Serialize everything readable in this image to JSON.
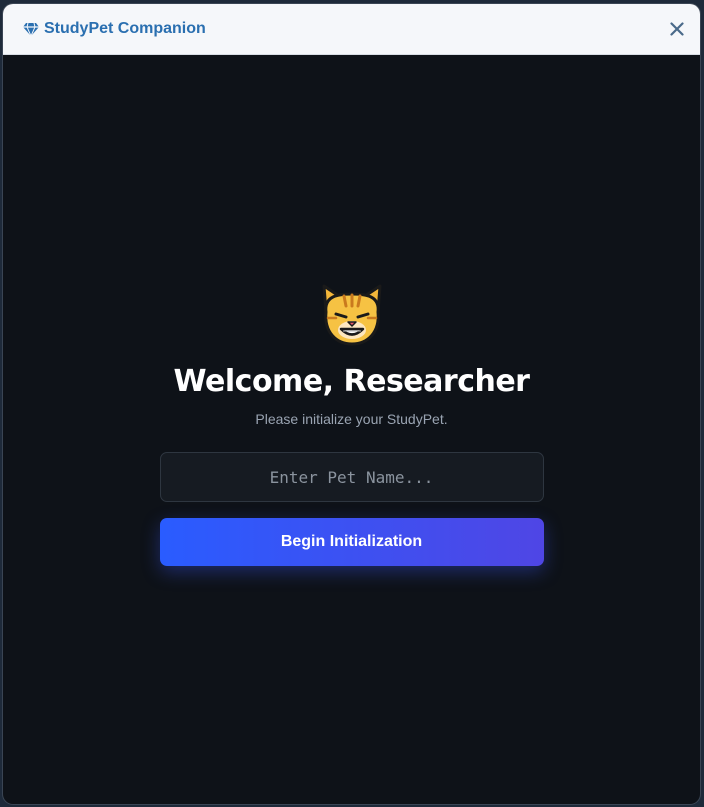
{
  "window": {
    "title": "StudyPet Companion",
    "title_icon": "diamond-icon",
    "close_icon": "close-icon"
  },
  "main": {
    "avatar_icon": "cat-face-icon",
    "heading": "Welcome, Researcher",
    "subtitle": "Please initialize your StudyPet.",
    "pet_name_placeholder": "Enter Pet Name...",
    "pet_name_value": "",
    "begin_label": "Begin Initialization"
  },
  "colors": {
    "titlebar_bg": "#f5f7fa",
    "title_text": "#2a6fb0",
    "content_bg": "#0e1218",
    "button_gradient_start": "#2a5cff",
    "button_gradient_end": "#4f46e5"
  }
}
